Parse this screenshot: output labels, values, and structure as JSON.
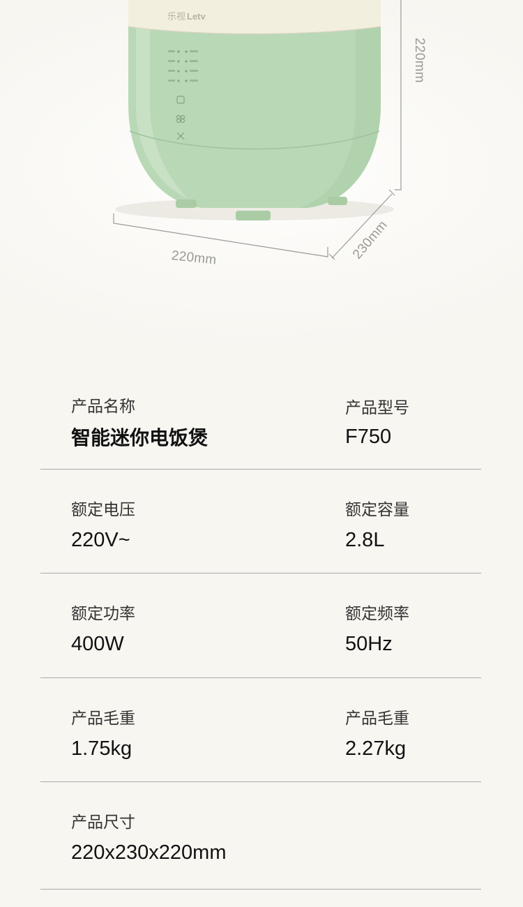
{
  "product_image": {
    "brand_cn": "乐视",
    "brand_en": "Letv",
    "dimension_width": "220mm",
    "dimension_depth": "230mm",
    "dimension_height": "220mm",
    "body_color": "#b9d8b6",
    "lid_color": "#f3efdf"
  },
  "specs": [
    {
      "left": {
        "label": "产品名称",
        "value": "智能迷你电饭煲"
      },
      "right": {
        "label": "产品型号",
        "value": "F750"
      }
    },
    {
      "left": {
        "label": "额定电压",
        "value": "220V~"
      },
      "right": {
        "label": "额定容量",
        "value": "2.8L"
      }
    },
    {
      "left": {
        "label": "额定功率",
        "value": "400W"
      },
      "right": {
        "label": "额定频率",
        "value": "50Hz"
      }
    },
    {
      "left": {
        "label": "产品毛重",
        "value": "1.75kg"
      },
      "right": {
        "label": "产品毛重",
        "value": "2.27kg"
      }
    },
    {
      "left": {
        "label": "产品尺寸",
        "value": "220x230x220mm"
      }
    }
  ]
}
